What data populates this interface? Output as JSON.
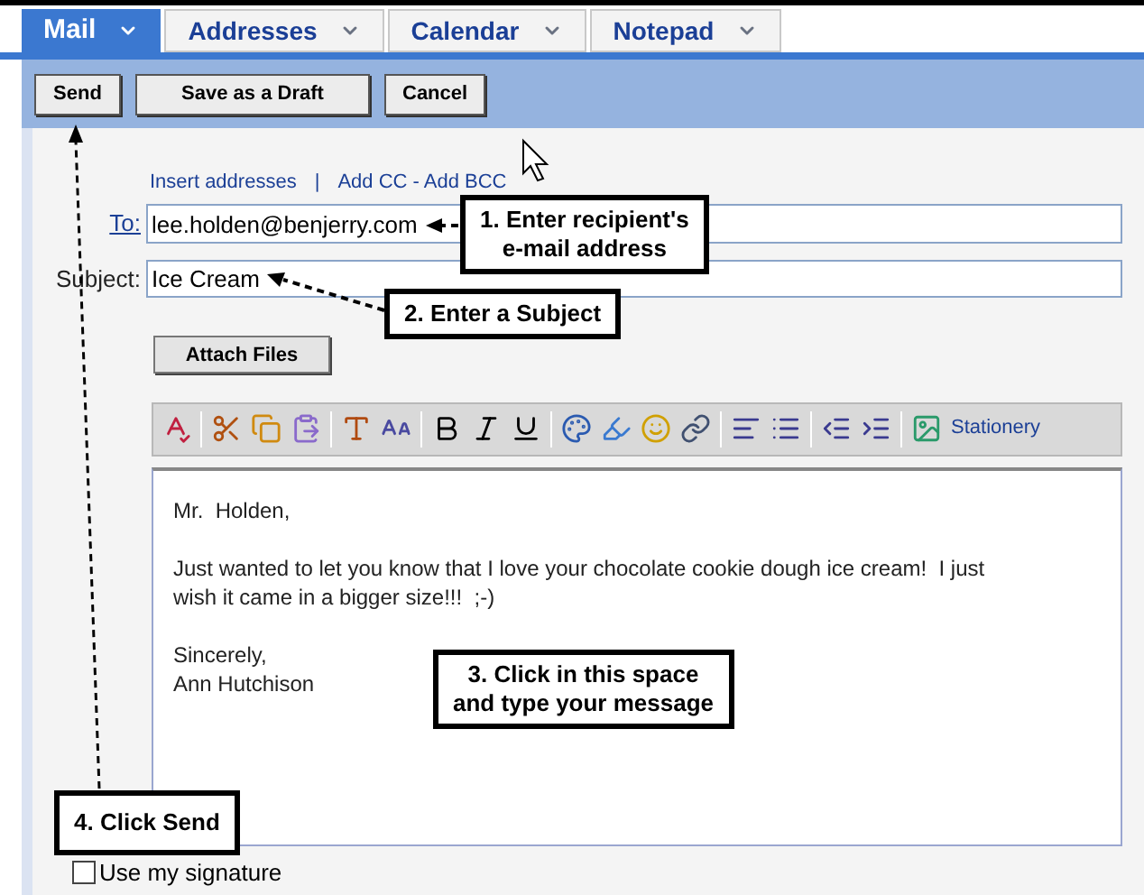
{
  "tabs": [
    {
      "label": "Mail",
      "selected": true
    },
    {
      "label": "Addresses",
      "selected": false
    },
    {
      "label": "Calendar",
      "selected": false
    },
    {
      "label": "Notepad",
      "selected": false
    }
  ],
  "actions": [
    "Send",
    "Save as a Draft",
    "Cancel"
  ],
  "address_links": [
    "Insert addresses",
    "|",
    "Add CC - Add BCC"
  ],
  "to": {
    "label": "To:",
    "value": "lee.holden@benjerry.com"
  },
  "subject": {
    "label": "Subject:",
    "value": "Ice Cream"
  },
  "attach_button": "Attach Files",
  "toolbar": {
    "stationery": "Stationery"
  },
  "message": {
    "paragraphs": [
      [
        "Mr.  Holden,"
      ],
      [
        "Just wanted to let you know that I love your chocolate cookie dough ice cream!  I just",
        "wish it came in a bigger size!!!  ;-)"
      ],
      [
        "Sincerely,",
        "Ann Hutchison"
      ]
    ]
  },
  "signature": {
    "label": "Use my signature",
    "checked": false
  },
  "callouts": [
    {
      "lines": [
        "1.  Enter recipient's",
        "e-mail address"
      ]
    },
    {
      "lines": [
        "2. Enter a Subject"
      ]
    },
    {
      "lines": [
        "3.  Click in this space",
        "and type your message"
      ]
    },
    {
      "lines": [
        "4.  Click Send"
      ]
    }
  ]
}
